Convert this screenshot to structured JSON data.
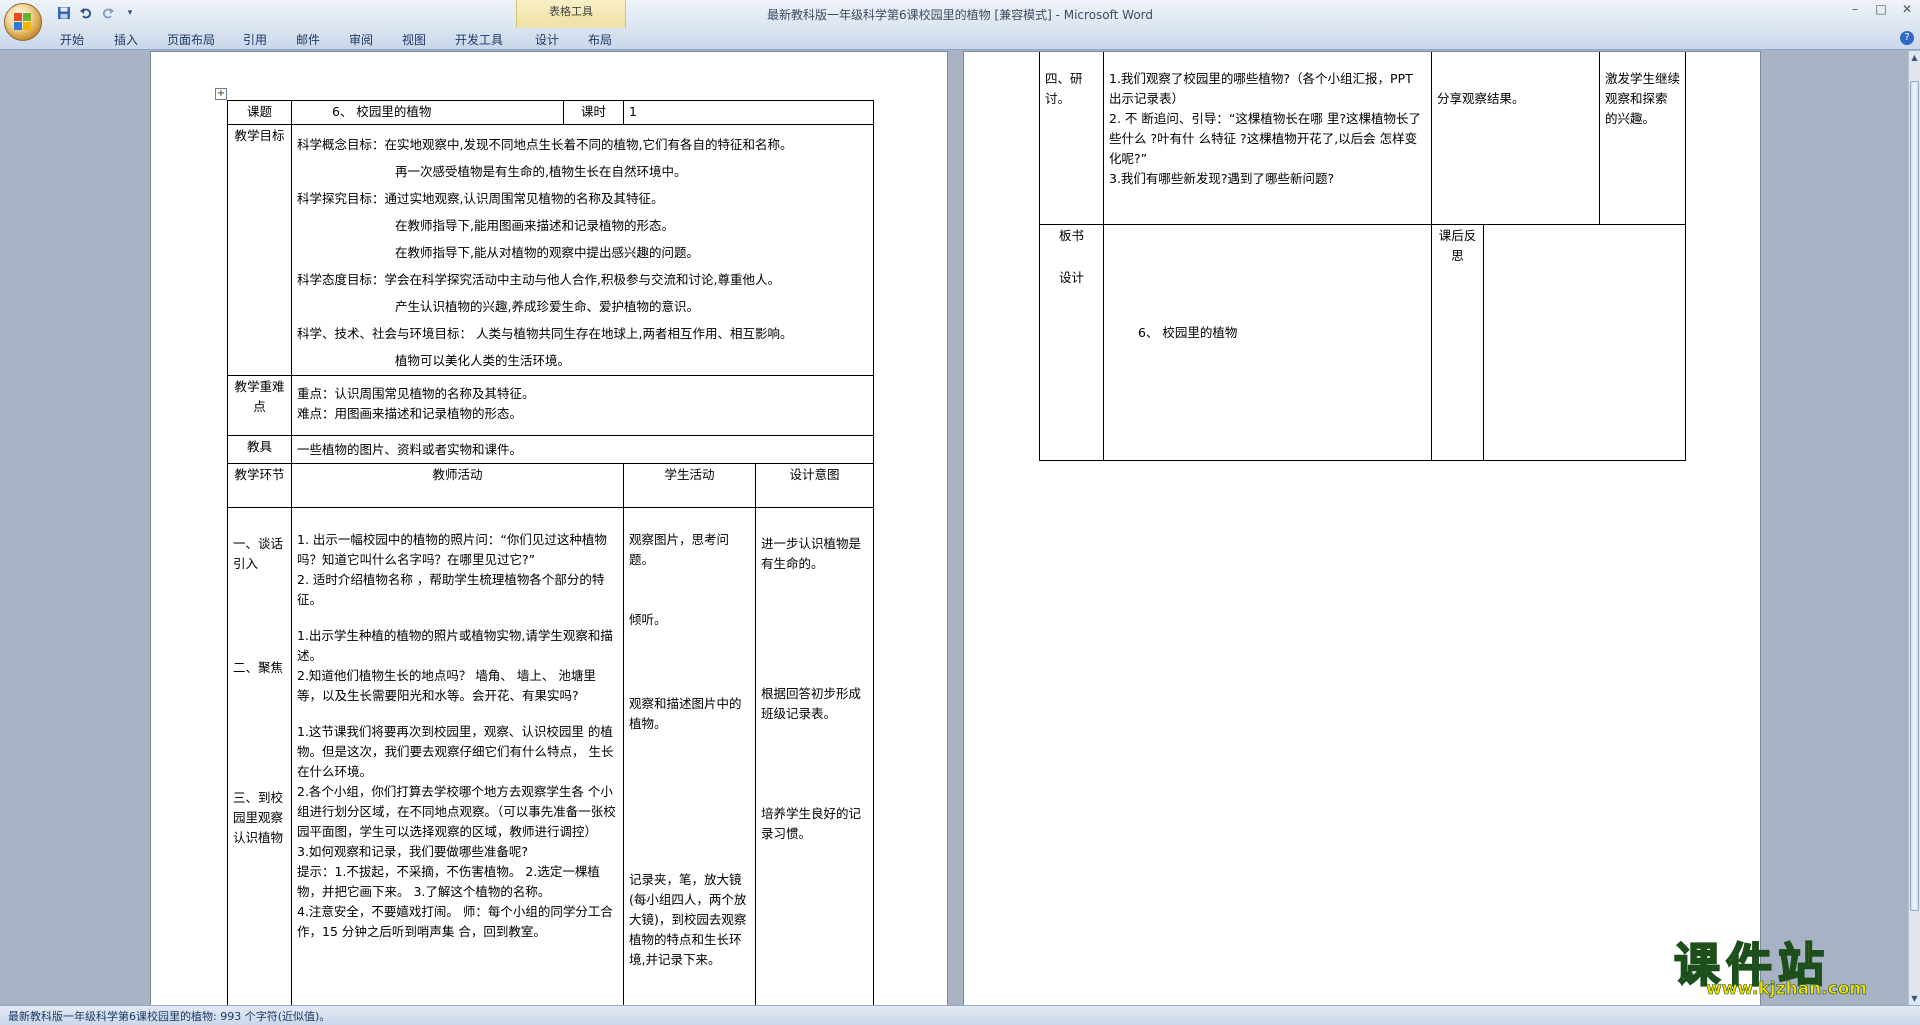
{
  "window": {
    "title": "最新教科版一年级科学第6课校园里的植物 [兼容模式] - Microsoft Word",
    "context_tab_group": "表格工具"
  },
  "ribbon": {
    "tabs": [
      "开始",
      "插入",
      "页面布局",
      "引用",
      "邮件",
      "审阅",
      "视图",
      "开发工具",
      "设计",
      "布局"
    ]
  },
  "status_bar": {
    "text": "最新教科版一年级科学第6课校园里的植物: 993 个字符(近似值)。"
  },
  "watermark": {
    "brand": "课件站",
    "url": "www.kjzhan.com"
  },
  "page1": {
    "header": {
      "topic_label": "课题",
      "topic": "6、 校园里的植物",
      "period_label": "课时",
      "period": "1"
    },
    "goals": {
      "label": "教学目标",
      "lines": [
        "科学概念目标：在实地观察中,发现不同地点生长着不同的植物,它们有各自的特征和名称。",
        "再一次感受植物是有生命的,植物生长在自然环境中。",
        "科学探究目标：通过实地观察,认识周围常见植物的名称及其特征。",
        "在教师指导下,能用图画来描述和记录植物的形态。",
        "在教师指导下,能从对植物的观察中提出感兴趣的问题。",
        "科学态度目标：学会在科学探究活动中主动与他人合作,积极参与交流和讨论,尊重他人。",
        "产生认识植物的兴趣,养成珍爱生命、爱护植物的意识。",
        "科学、技术、社会与环境目标： 人类与植物共同生存在地球上,两者相互作用、相互影响。",
        "植物可以美化人类的生活环境。"
      ]
    },
    "key_points": {
      "label": "教学重难点",
      "lines": [
        "重点：认识周围常见植物的名称及其特征。",
        "难点：用图画来描述和记录植物的形态。"
      ]
    },
    "materials": {
      "label": "教具",
      "text": "一些植物的图片、资料或者实物和课件。"
    },
    "columns": {
      "stage": "教学环节",
      "teacher": "教师活动",
      "student": "学生活动",
      "intent": "设计意图"
    },
    "stages": [
      "一、谈话引入",
      "二、聚焦",
      "三、到校园里观察认识植物"
    ],
    "teacher_lines": [
      "1. 出示一幅校园中的植物的照片问：“你们见过这种植物吗？知道它叫什么名字吗？在哪里见过它?”",
      "2. 适时介绍植物名称 ，帮助学生梳理植物各个部分的特征。",
      "1.出示学生种植的植物的照片或植物实物,请学生观察和描述。",
      "2.知道他们植物生长的地点吗？ 墙角、 墙上、 池塘里等，以及生长需要阳光和水等。会开花、有果实吗?",
      "1.这节课我们将要再次到校园里，观察、认识校园里 的植物。但是这次，我们要去观察仔细它们有什么特点， 生长在什么环境。",
      "2.各个小组，你们打算去学校哪个地方去观察学生各 个小组进行划分区域，在不同地点观察。（可以事先准备一张校园平面图，学生可以选择观察的区域，教师进行调控）",
      "3.如何观察和记录，我们要做哪些准备呢?",
      "提示：1.不拔起，不采摘，不伤害植物。 2.选定一棵植物，并把它画下来。 3.了解这个植物的名称。",
      "4.注意安全，不要嬉戏打闹。 师：每个小组的同学分工合作，15 分钟之后听到哨声集 合，回到教室。"
    ],
    "student_lines": [
      "观察图片，思考问题。",
      "倾听。",
      "观察和描述图片中的植物。",
      "记录夹，笔，放大镜(每小组四人，两个放 大镜)，到校园去观察植物的特点和生长环境,并记录下来。"
    ],
    "intent_lines": [
      "进一步认识植物是有生命的。",
      "根据回答初步形成班级记录表。",
      "培养学生良好的记录习惯。"
    ]
  },
  "page2": {
    "stage4": "四、研讨。",
    "teacher_lines": [
      "1.我们观察了校园里的哪些植物?（各个小组汇报，PPT 出示记录表）",
      "2. 不 断追问、引导：“这棵植物长在哪 里?这棵植物长了些什么 ?叶有什 么特征 ?这棵植物开花了,以后会 怎样变化呢?”",
      "3.我们有哪些新发现?遇到了哪些新问题?"
    ],
    "student": "分享观察结果。",
    "intent": "激发学生继续观察和探索 的兴趣。",
    "board_label_1": "板书",
    "board_label_2": "设计",
    "board_content": "6、 校园里的植物",
    "reflection_label": "课后反思"
  },
  "colors": {
    "ribbon_text": "#1e3966",
    "workspace": "#a7b3c4",
    "watermark_yellow": "#f5e000",
    "watermark_outline": "#1c4f1c"
  },
  "icons": [
    "office-button-icon",
    "save-icon",
    "undo-icon",
    "redo-icon",
    "customize-qat-icon",
    "minimize-icon",
    "maximize-icon",
    "close-icon",
    "help-icon",
    "table-move-handle-icon"
  ]
}
